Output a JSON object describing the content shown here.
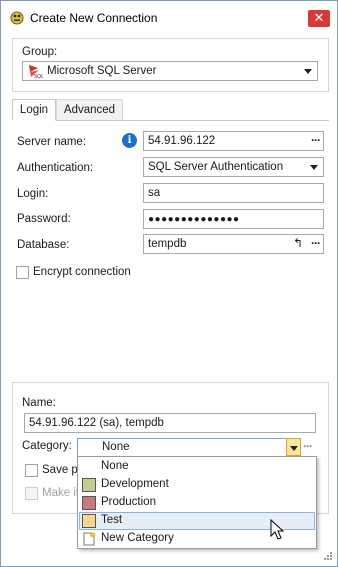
{
  "window": {
    "title": "Create New Connection"
  },
  "group": {
    "label": "Group:",
    "value": "Microsoft SQL Server",
    "icon": "sql-server-icon"
  },
  "tabs": [
    {
      "label": "Login",
      "active": true
    },
    {
      "label": "Advanced",
      "active": false
    }
  ],
  "login": {
    "server_name_label": "Server name:",
    "server_name_value": "54.91.96.122",
    "auth_label": "Authentication:",
    "auth_value": "SQL Server Authentication",
    "login_label": "Login:",
    "login_value": "sa",
    "password_label": "Password:",
    "password_value": "●●●●●●●●●●●●●●",
    "database_label": "Database:",
    "database_value": "tempdb",
    "encrypt_label": "Encrypt connection",
    "encrypt_checked": false
  },
  "bottom": {
    "name_label": "Name:",
    "name_value": "54.91.96.122 (sa), tempdb",
    "category_label": "Category:",
    "category_value": "None",
    "save_label": "Save pa",
    "make_label": "Make it"
  },
  "category_options": [
    {
      "label": "None",
      "color": ""
    },
    {
      "label": "Development",
      "color": "#c5cc8e"
    },
    {
      "label": "Production",
      "color": "#c97a7a"
    },
    {
      "label": "Test",
      "color": "#f6d68c",
      "selected": true
    },
    {
      "label": "New Category",
      "icon": "new-document-icon"
    }
  ],
  "buttons": {
    "ellipsis": "···",
    "close": "✕"
  },
  "colors": {
    "selection": "#e5eef7",
    "accent": "#1f6fc5",
    "close": "#d63c36"
  }
}
